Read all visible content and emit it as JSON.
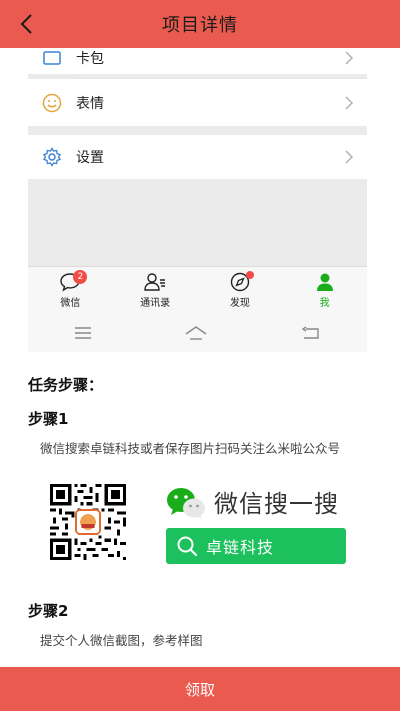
{
  "header": {
    "title": "项目详情"
  },
  "screenshot": {
    "menu": [
      {
        "label": "卡包",
        "icon": "card-wallet-icon"
      },
      {
        "label": "表情",
        "icon": "emoji-icon"
      },
      {
        "label": "设置",
        "icon": "gear-icon"
      }
    ],
    "tabs": [
      {
        "label": "微信",
        "badge": "2"
      },
      {
        "label": "通讯录"
      },
      {
        "label": "发现"
      },
      {
        "label": "我"
      }
    ]
  },
  "task": {
    "heading": "任务步骤：",
    "step1": {
      "title": "步骤1",
      "text": "微信搜索卓链科技或者保存图片扫码关注么米啦公众号"
    },
    "promo": {
      "brand": "微信搜一搜",
      "search_term": "卓链科技"
    },
    "step2": {
      "title": "步骤2",
      "text": "提交个人微信截图，参考样图"
    }
  },
  "footer": {
    "button": "领取"
  },
  "colors": {
    "accent": "#ea5a4f",
    "wechat_green": "#1aad19"
  }
}
